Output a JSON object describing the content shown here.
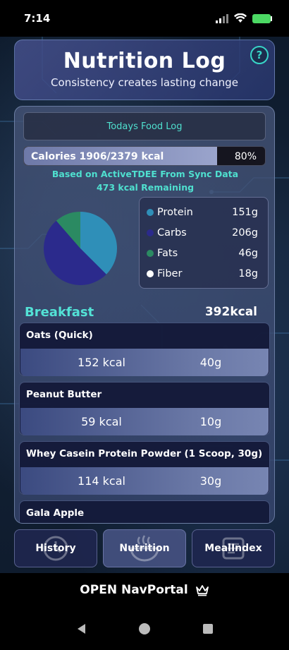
{
  "status_bar": {
    "time": "7:14"
  },
  "header": {
    "title": "Nutrition Log",
    "subtitle": "Consistency creates lasting change",
    "help_label": "?"
  },
  "log": {
    "title": "Todays Food Log",
    "calories_label": "Calories  1906/2379 kcal",
    "calories_percent_label": "80%",
    "calories_progress": 0.8,
    "note": "Based on ActiveTDEE From Sync Data",
    "remaining": "473 kcal Remaining"
  },
  "macros": [
    {
      "name": "Protein",
      "value": "151g",
      "grams": 151,
      "color": "#2f8fb8"
    },
    {
      "name": "Carbs",
      "value": "206g",
      "grams": 206,
      "color": "#2b2a8c"
    },
    {
      "name": "Fats",
      "value": "46g",
      "grams": 46,
      "color": "#2b8a62"
    },
    {
      "name": "Fiber",
      "value": "18g",
      "grams": 18,
      "color": "#ffffff"
    }
  ],
  "meal": {
    "name": "Breakfast",
    "kcal": "392kcal",
    "items": [
      {
        "name": "Oats (Quick)",
        "kcal": "152 kcal",
        "grams": "40g"
      },
      {
        "name": "Peanut Butter",
        "kcal": "59 kcal",
        "grams": "10g"
      },
      {
        "name": "Whey Casein Protein Powder (1 Scoop, 30g)",
        "kcal": "114 kcal",
        "grams": "30g"
      },
      {
        "name": "Gala Apple",
        "kcal": "",
        "grams": ""
      }
    ]
  },
  "nav": {
    "history": "History",
    "nutrition": "Nutrition",
    "mealindex": "MealIndex"
  },
  "portal": {
    "label": "OPEN NavPortal"
  },
  "colors": {
    "accent": "#4fe0cf",
    "meal_title": "#53e2d6"
  }
}
